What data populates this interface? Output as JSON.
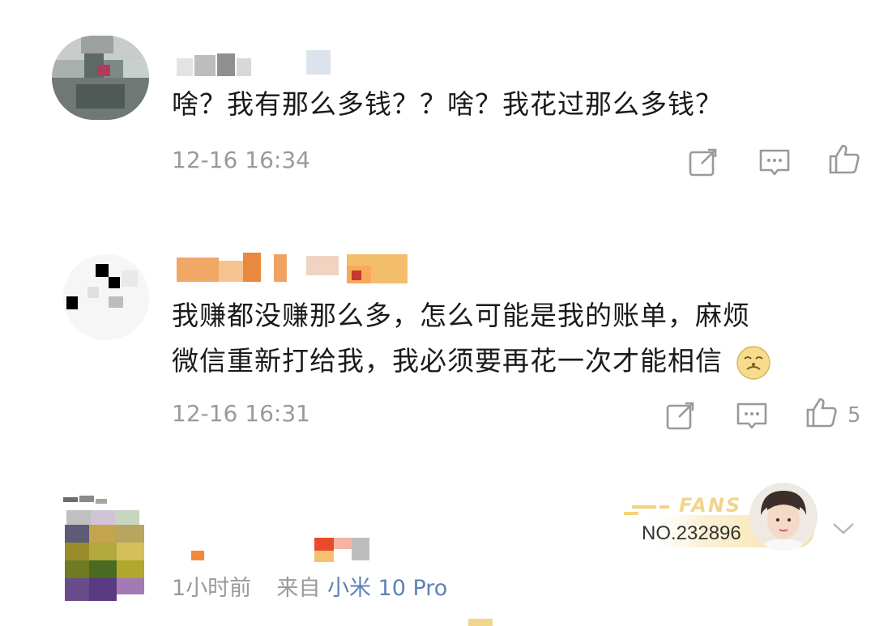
{
  "comments": [
    {
      "text": "啥？我有那么多钱？？啥？我花过那么多钱？",
      "time": "12-16 16:34",
      "like_count": ""
    },
    {
      "text_line1": "我赚都没赚那么多，怎么可能是我的账单，麻烦",
      "text_line2": "微信重新打给我，我必须要再花一次才能相信",
      "emoji": "emoji-face",
      "time": "12-16 16:31",
      "like_count": "5"
    },
    {
      "time_ago": "1小时前",
      "source_prefix": "来自",
      "source_device": "小米 10 Pro",
      "badge": {
        "label": "FANS",
        "number": "NO.232896"
      }
    }
  ],
  "icons": {
    "forward": "share-edit-icon",
    "comment": "comment-icon",
    "like": "thumbs-up-icon",
    "expand": "chevron-down-icon"
  },
  "colors": {
    "text": "#1a1a1a",
    "meta": "#9a9a9a",
    "source_device": "#5d82b6",
    "badge_gold": "#f1d58d"
  }
}
